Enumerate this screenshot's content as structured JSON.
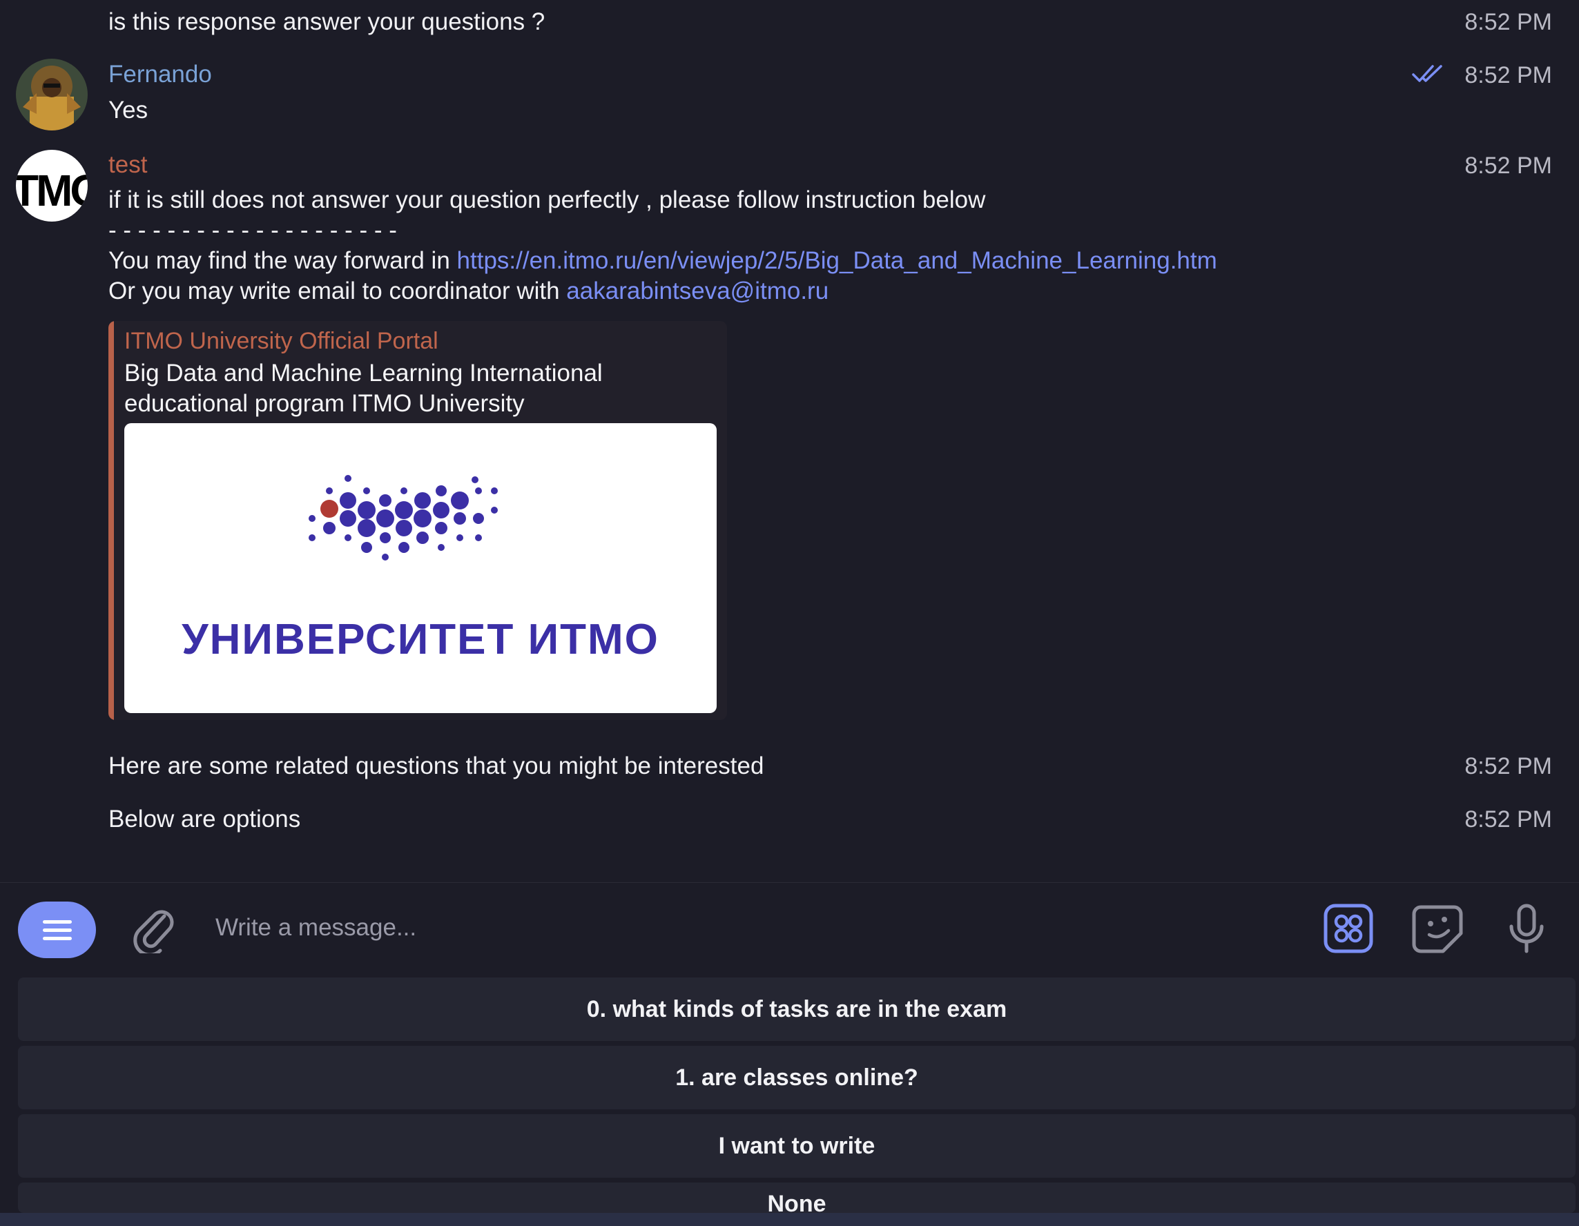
{
  "messages": [
    {
      "text": "is this response answer your questions ?",
      "time": "8:52 PM"
    },
    {
      "sender": "Fernando",
      "text": "Yes",
      "time": "8:52 PM",
      "status": "read"
    },
    {
      "sender": "test",
      "time": "8:52 PM",
      "avatar_text": "TMO",
      "line1": "if it is still does not answer your question perfectly , please follow instruction below",
      "separator": "- - - - - - - - - - - - - - - - - - - -",
      "line3_prefix": "You may find the way forward in ",
      "line3_link": "https://en.itmo.ru/en/viewjep/2/5/Big_Data_and_Machine_Learning.htm",
      "line4_prefix": "Or you may write email to coordinator with ",
      "line4_link": "aakarabintseva@itmo.ru",
      "preview": {
        "site": "ITMO University Official Portal",
        "title": "Big Data and Machine Learning International educational program ITMO University",
        "image_text": "УНИВЕРСИТЕТ ИТМО"
      }
    },
    {
      "text": "Here are some related questions that you might be interested",
      "time": "8:52 PM"
    },
    {
      "text": "Below are options",
      "time": "8:52 PM"
    }
  ],
  "composer": {
    "placeholder": "Write a message..."
  },
  "keyboard": {
    "buttons": [
      "0. what kinds of tasks are in the exam",
      "1. are classes online?",
      "I want to write",
      "None"
    ]
  },
  "colors": {
    "background": "#1c1c27",
    "accent": "#7b8ff5",
    "sender_fernando": "#7aa2d6",
    "sender_test": "#c0654c",
    "logo": "#3b2fa6"
  },
  "icons": [
    "menu-icon",
    "paperclip-icon",
    "apps-icon",
    "sticker-icon",
    "microphone-icon",
    "double-check-icon"
  ]
}
